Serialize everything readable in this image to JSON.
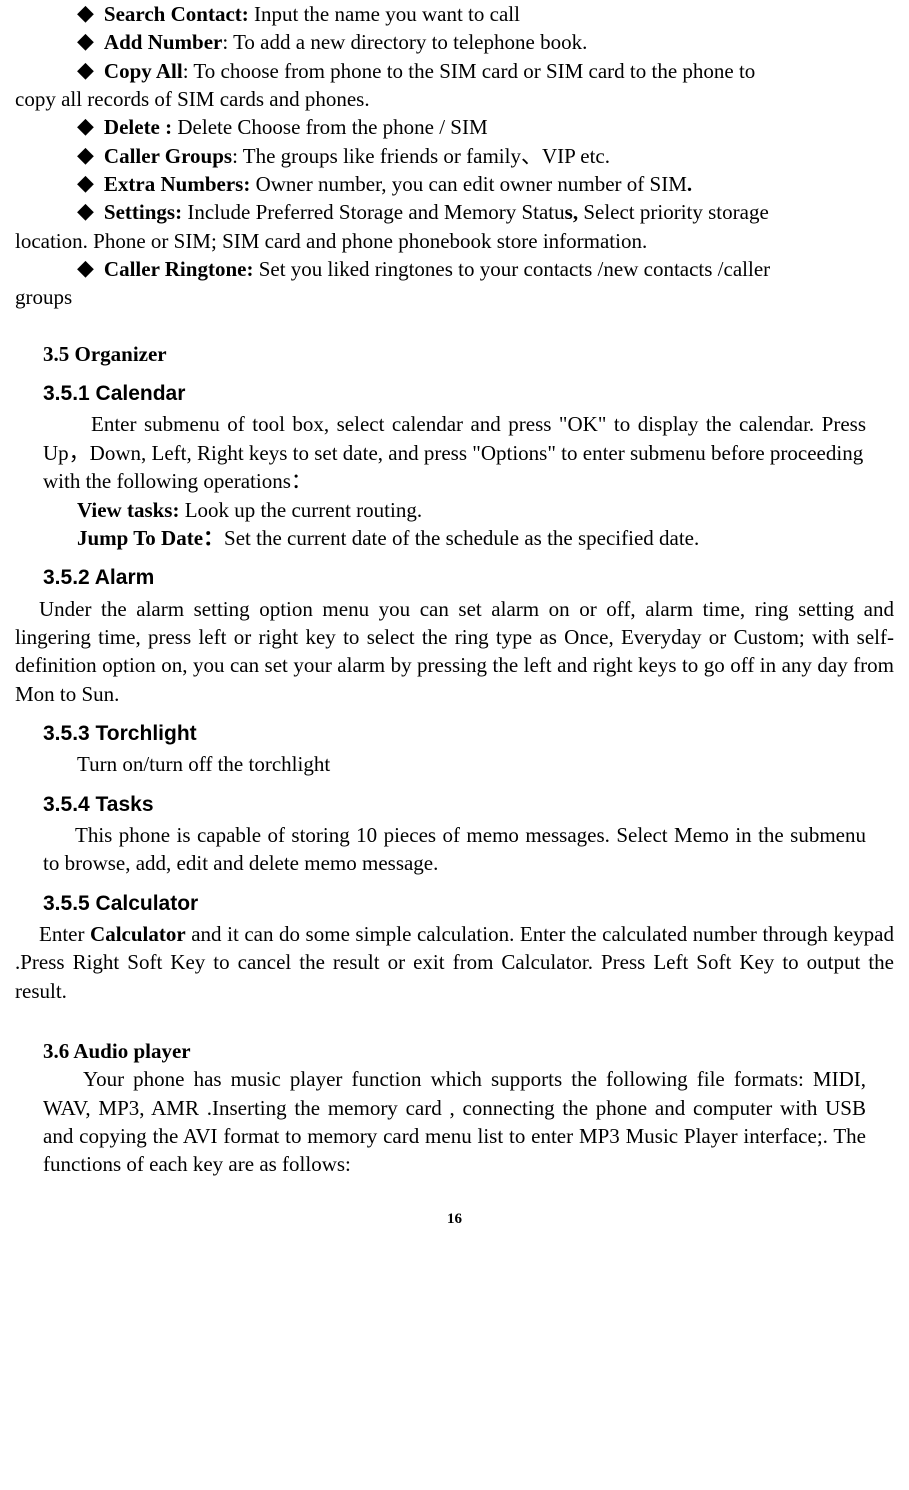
{
  "bullets": [
    {
      "title": "Search Contact:",
      "rest": " Input the name you want to call"
    },
    {
      "title": "Add Number",
      "rest": ": To add a new directory to telephone book."
    },
    {
      "title": "Copy All",
      "rest": ": To choose from phone to the SIM card or SIM card to the phone to",
      "cont": "copy all records of SIM cards and phones."
    },
    {
      "title": "Delete :",
      "rest": " Delete Choose from the phone / SIM"
    },
    {
      "title": "Caller Groups",
      "rest": ": The groups like friends or family、VIP etc."
    },
    {
      "title": "Extra Numbers:",
      "rest": " Owner number, you can edit owner number of SIM",
      "tail_bold": "."
    },
    {
      "title": "Settings:",
      "rest": " Include Preferred Storage and Memory Statu",
      "mid_bold": "s,",
      "rest2": " Select priority storage",
      "cont": "location. Phone or SIM; SIM card and phone phonebook store information."
    },
    {
      "title": "Caller Ringtone:",
      "rest": " Set you liked ringtones to your contacts /new contacts /caller",
      "cont": "groups"
    }
  ],
  "organizer_heading": "3.5 Organizer",
  "calendar": {
    "heading": "3.5.1 Calendar",
    "p1": "Enter submenu of tool box, select calendar and press \"OK\" to display the calendar. Press Up，Down, Left, Right keys to set date, and press \"Options\" to enter submenu before proceeding",
    "p2": "with the following operations：",
    "view_label": "View tasks:",
    "view_rest": "  Look up the current routing.",
    "jump_label": "Jump To Date：",
    "jump_rest": "Set the current date of the schedule as the specified date."
  },
  "alarm": {
    "heading": "3.5.2 Alarm",
    "body": "Under the alarm setting option menu you can set alarm on or off, alarm time, ring setting and lingering time, press left or right key to select the ring type as Once, Everyday or Custom; with self-definition option on, you can set your alarm by pressing the left and right keys to go off in any day from Mon to Sun."
  },
  "torch": {
    "heading": "3.5.3 Torchlight",
    "body": "Turn on/turn off the torchlight"
  },
  "tasks": {
    "heading": "3.5.4 Tasks",
    "body": "This phone is capable of storing 10 pieces of memo messages. Select Memo in the submenu to browse, add, edit and delete memo message."
  },
  "calc": {
    "heading": "3.5.5 Calculator",
    "pre": "Enter ",
    "bold": "Calculator",
    "post": " and it can do some simple calculation. Enter the calculated number through keypad .Press Right Soft Key to cancel the result or exit from Calculator. Press Left Soft Key to output the result."
  },
  "audio": {
    "heading": "3.6 Audio player",
    "body": "Your phone has music player function which supports the following file formats: MIDI, WAV, MP3, AMR .Inserting the memory card , connecting the phone and computer with USB and copying the AVI format to memory card menu list to enter MP3 Music Player interface;. The functions of each key are as follows:"
  },
  "page_number": "16"
}
